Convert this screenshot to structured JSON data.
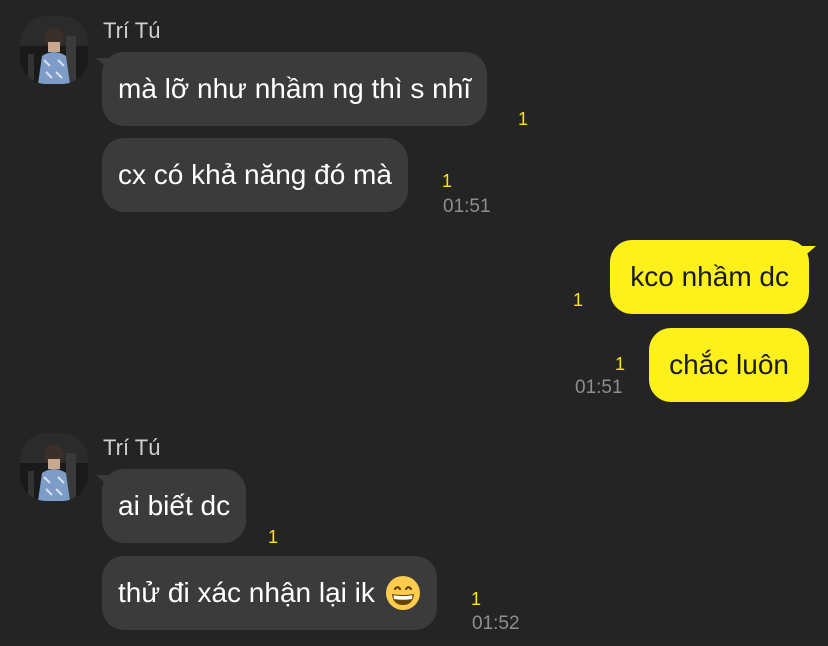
{
  "chat": {
    "groups": [
      {
        "sender": "Trí Tú",
        "messages": [
          {
            "text": "mà lỡ như nhầm ng thì s nhĩ",
            "unread": "1",
            "time": ""
          },
          {
            "text": "cx có khả năng đó mà",
            "unread": "1",
            "time": "01:51"
          }
        ]
      },
      {
        "sender": "",
        "messages": [
          {
            "text": "kco nhầm dc",
            "unread": "1",
            "time": ""
          },
          {
            "text": "chắc luôn",
            "unread": "1",
            "time": "01:51"
          }
        ]
      },
      {
        "sender": "Trí Tú",
        "messages": [
          {
            "text": "ai biết dc",
            "unread": "1",
            "time": ""
          },
          {
            "text": "thử đi xác nhận lại ik",
            "emoji": "grinning-face-icon",
            "unread": "1",
            "time": "01:52"
          }
        ]
      }
    ]
  },
  "colors": {
    "background": "#242424",
    "incoming_bubble": "#3b3b3b",
    "outgoing_bubble": "#fef01b",
    "unread_count": "#fee500",
    "timestamp": "#8e8e8e"
  }
}
